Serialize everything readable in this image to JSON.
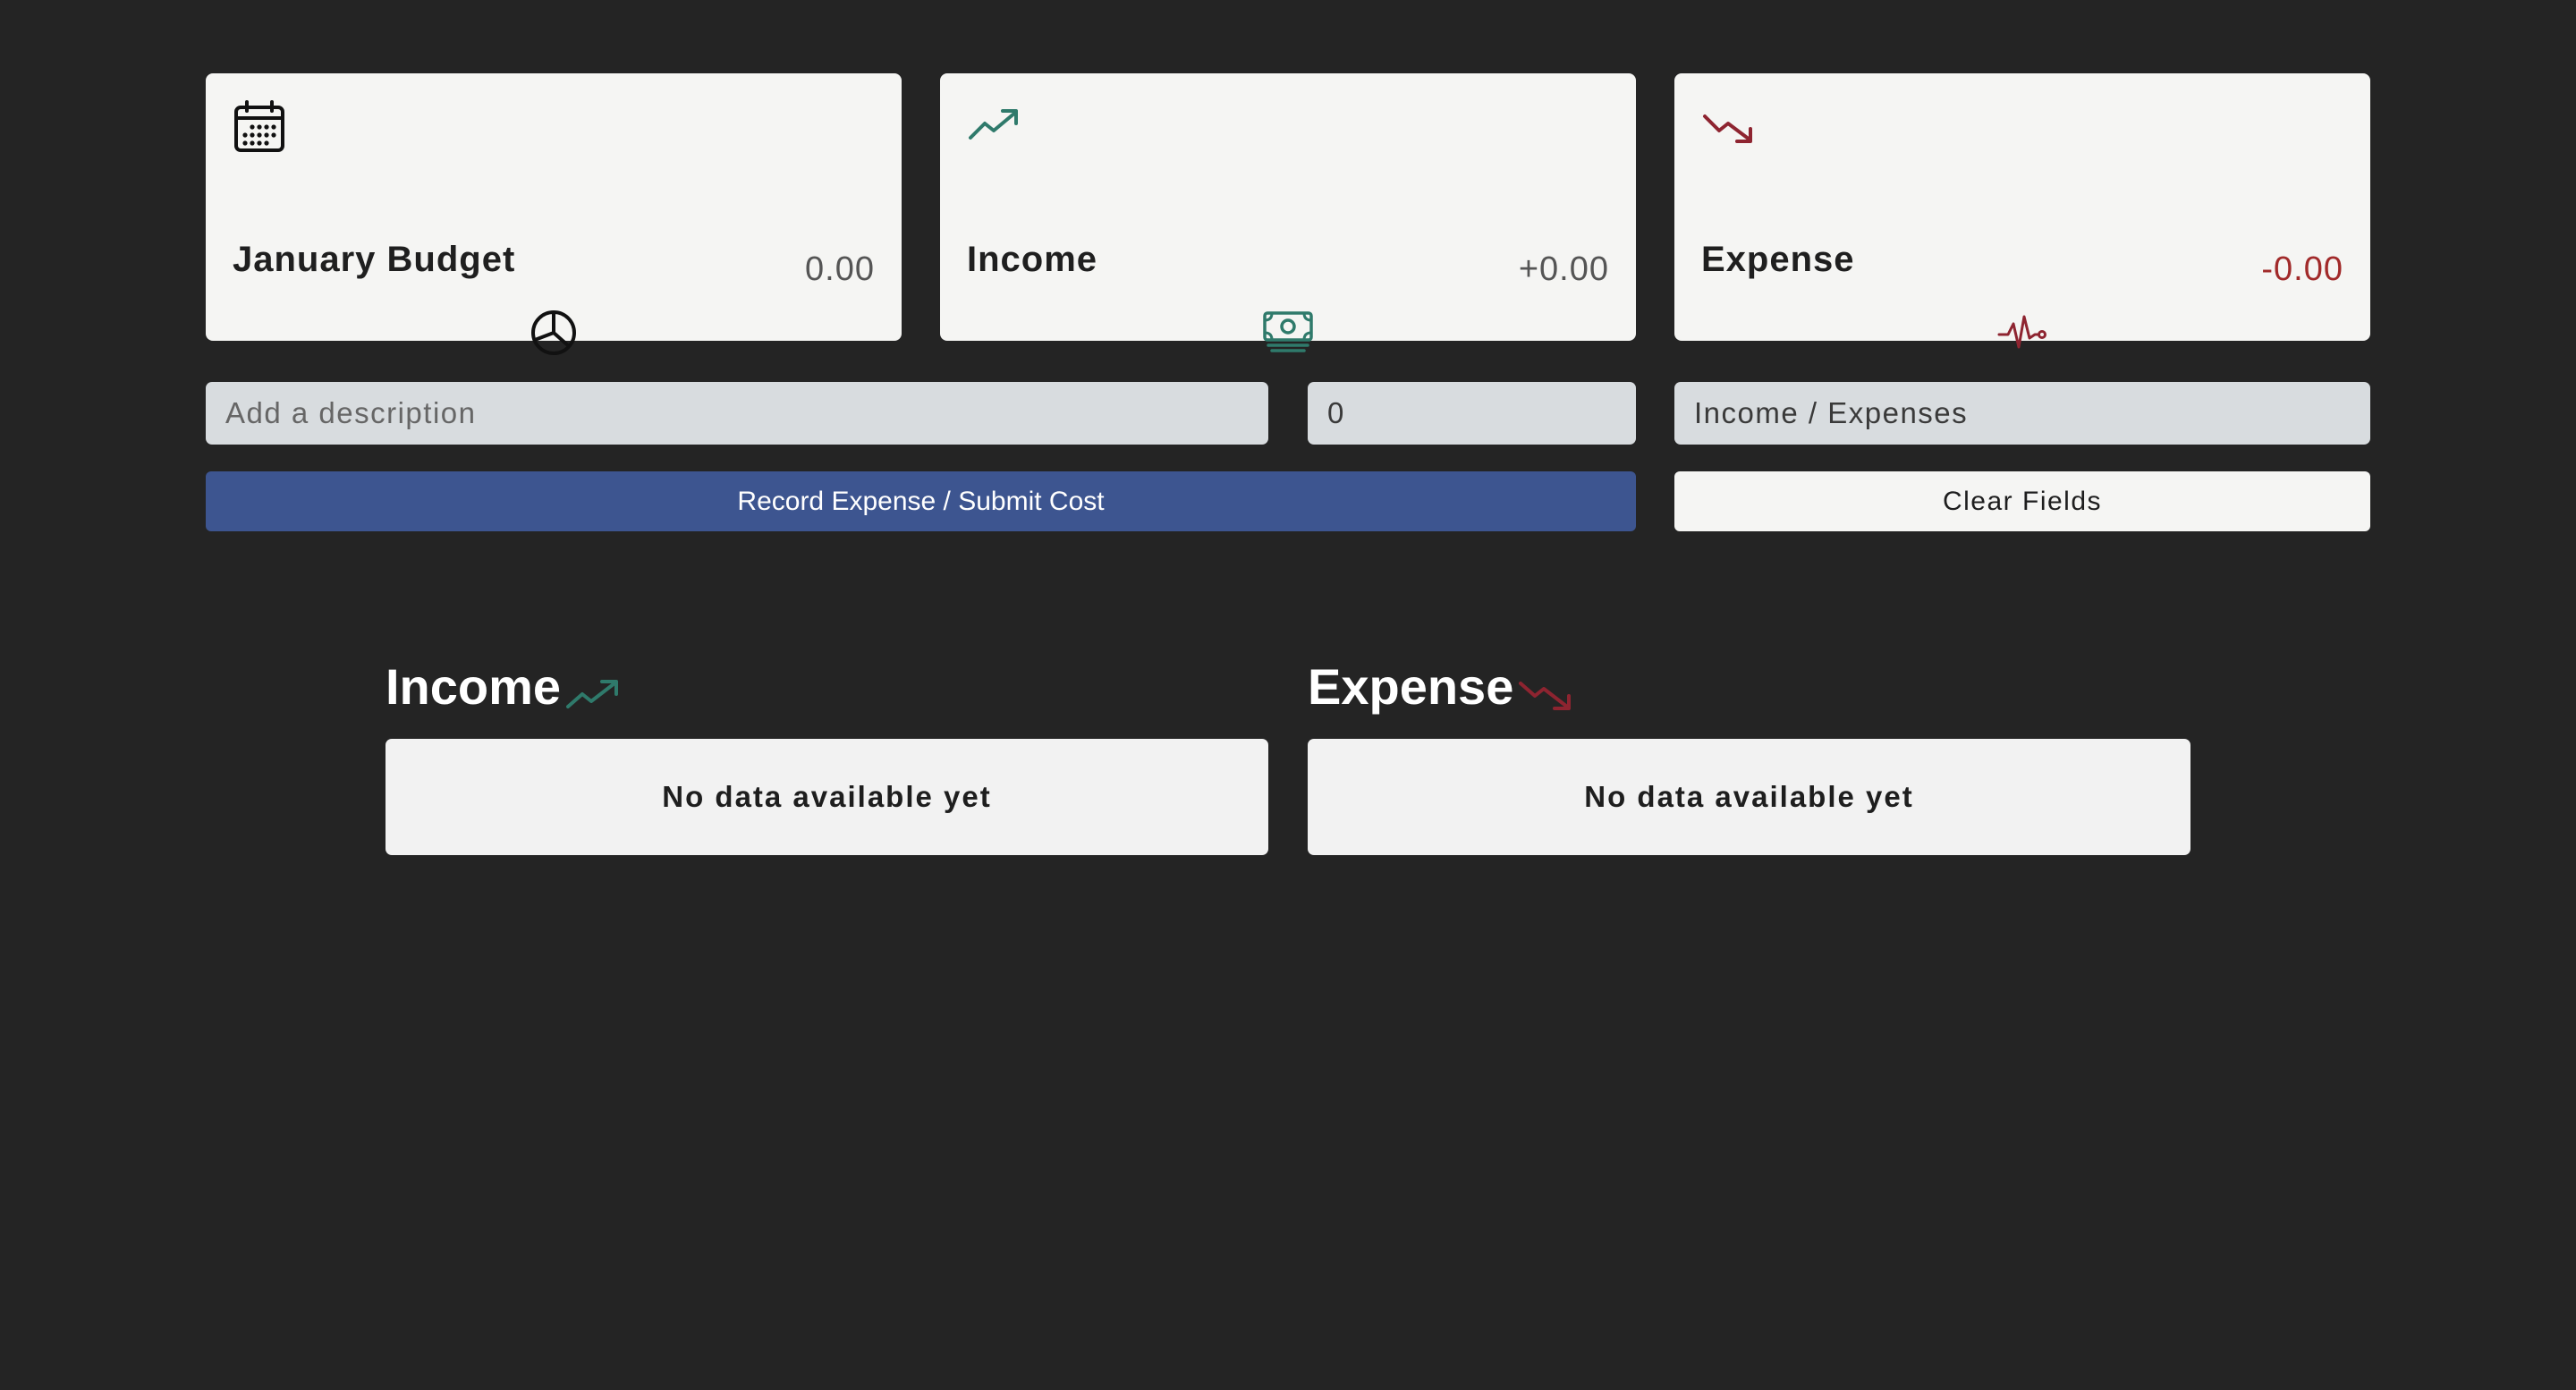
{
  "cards": {
    "budget": {
      "title": "January Budget",
      "value": "0.00",
      "top_icon": "calendar-icon",
      "bottom_icon": "pie-chart-icon"
    },
    "income": {
      "title": "Income",
      "value": "+0.00",
      "top_icon": "trending-up-icon",
      "bottom_icon": "cash-icon",
      "color": "#2f7a6b"
    },
    "expense": {
      "title": "Expense",
      "value": "-0.00",
      "top_icon": "trending-down-icon",
      "bottom_icon": "pulse-icon",
      "color": "#8e2430"
    }
  },
  "form": {
    "description_placeholder": "Add a description",
    "amount_value": "0",
    "type_value": "Income / Expenses",
    "submit_label": "Record Expense / Submit Cost",
    "clear_label": "Clear Fields",
    "submit_color": "#3d5590"
  },
  "lists": {
    "income": {
      "title": "Income",
      "icon": "trending-up-icon",
      "empty_text": "No data available yet"
    },
    "expense": {
      "title": "Expense",
      "icon": "trending-down-icon",
      "empty_text": "No data available yet"
    }
  }
}
